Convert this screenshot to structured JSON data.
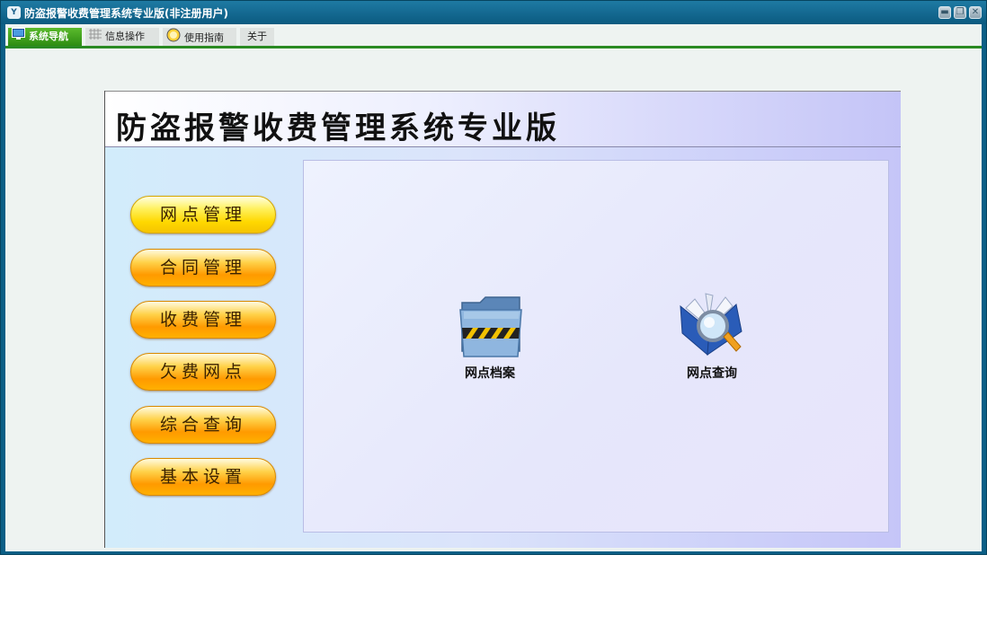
{
  "window": {
    "title": "防盗报警收费管理系统专业版(非注册用户)",
    "app_icon": "app-logo-icon",
    "controls": [
      "minimize-icon",
      "restore-icon",
      "close-icon"
    ]
  },
  "tabs": [
    {
      "label": "系统导航",
      "icon": "monitor-icon",
      "active": true
    },
    {
      "label": "信息操作",
      "icon": "grid-icon",
      "active": false
    },
    {
      "label": "使用指南",
      "icon": "help-icon",
      "active": false
    },
    {
      "label": "关于",
      "icon": "",
      "active": false
    }
  ],
  "banner": {
    "title": "防盗报警收费管理系统专业版"
  },
  "menu": [
    {
      "label": "网点管理",
      "selected": true
    },
    {
      "label": "合同管理",
      "selected": false
    },
    {
      "label": "收费管理",
      "selected": false
    },
    {
      "label": "欠费网点",
      "selected": false
    },
    {
      "label": "综合查询",
      "selected": false
    },
    {
      "label": "基本设置",
      "selected": false
    }
  ],
  "actions": [
    {
      "label": "网点档案",
      "icon": "folder-icon"
    },
    {
      "label": "网点查询",
      "icon": "search-book-icon"
    }
  ],
  "colors": {
    "accent_green": "#2a8a22",
    "titlebar": "#0c5f86",
    "button_orange": "#ff9a00",
    "button_yellow": "#ffd800"
  }
}
